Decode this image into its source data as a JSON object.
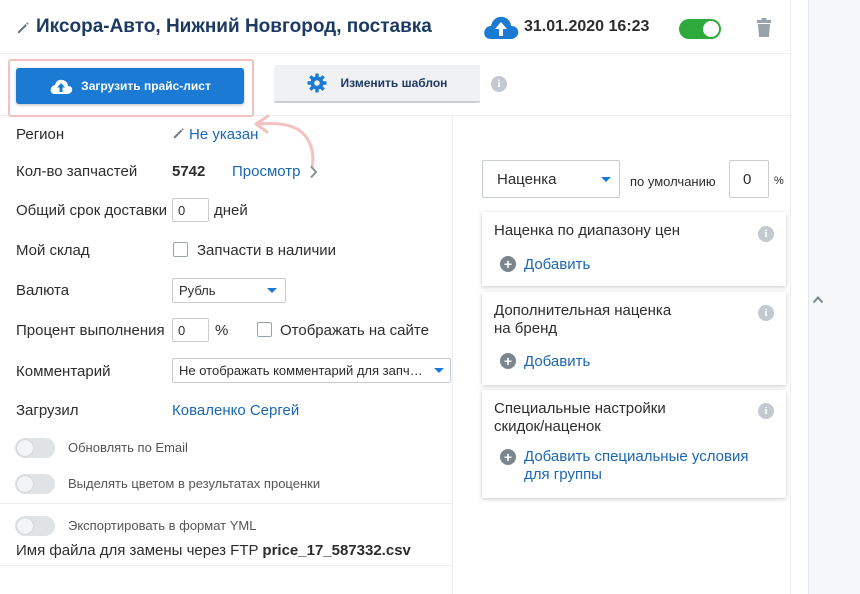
{
  "header": {
    "title": "Иксора-Авто, Нижний Новгород, поставка",
    "datetime": "31.01.2020 16:23",
    "toggle_enabled": true
  },
  "toolbar": {
    "upload_label": "Загрузить прайс-лист",
    "template_label": "Изменить шаблон",
    "info": "i"
  },
  "form": {
    "region": {
      "label": "Регион",
      "value": "Не указан"
    },
    "parts_count": {
      "label": "Кол-во запчастей",
      "value": "5742",
      "view_link": "Просмотр"
    },
    "delivery": {
      "label": "Общий срок доставки",
      "value": "0",
      "unit": "дней"
    },
    "warehouse": {
      "label": "Мой склад",
      "checkbox_label": "Запчасти в наличии",
      "checked": false
    },
    "currency": {
      "label": "Валюта",
      "value": "Рубль"
    },
    "fulfillment": {
      "label": "Процент выполнения",
      "value": "0",
      "unit": "%",
      "checkbox_label": "Отображать на сайте",
      "checked": false
    },
    "comment": {
      "label": "Комментарий",
      "value": "Не отображать комментарий для запчастей"
    },
    "uploader": {
      "label": "Загрузил",
      "value": "Коваленко Сергей"
    },
    "toggles": [
      {
        "label": "Обновлять по Email",
        "on": false
      },
      {
        "label": "Выделять цветом в результатах проценки",
        "on": false
      },
      {
        "label": "Экспортировать в формат YML",
        "on": false
      }
    ],
    "ftp": {
      "label": "Имя файла для замены через FTP",
      "value": "price_17_587332.csv"
    }
  },
  "markup": {
    "type_value": "Наценка",
    "default_label": "по умолчанию",
    "default_value": "0",
    "unit": "%"
  },
  "cards": [
    {
      "title": "Наценка по диапазону цен",
      "add_label": "Добавить",
      "info": "i"
    },
    {
      "title_line1": "Дополнительная наценка",
      "title_line2": "на бренд",
      "add_label": "Добавить",
      "info": "i"
    },
    {
      "title_line1": "Специальные настройки",
      "title_line2": "скидок/наценок",
      "add_line1": "Добавить специальные условия",
      "add_line2": "для группы",
      "info": "i"
    }
  ],
  "colors": {
    "primary": "#1a7ad4",
    "title": "#1d3a63",
    "link": "#1b67b4",
    "toggle_on": "#2eaa3c",
    "highlight": "#f3c1c0"
  },
  "icons": {
    "edit": "pencil-icon",
    "upload": "cloud-upload-icon",
    "template": "gear-icon",
    "delete": "trash-icon",
    "collapse": "chevron-up-icon"
  }
}
